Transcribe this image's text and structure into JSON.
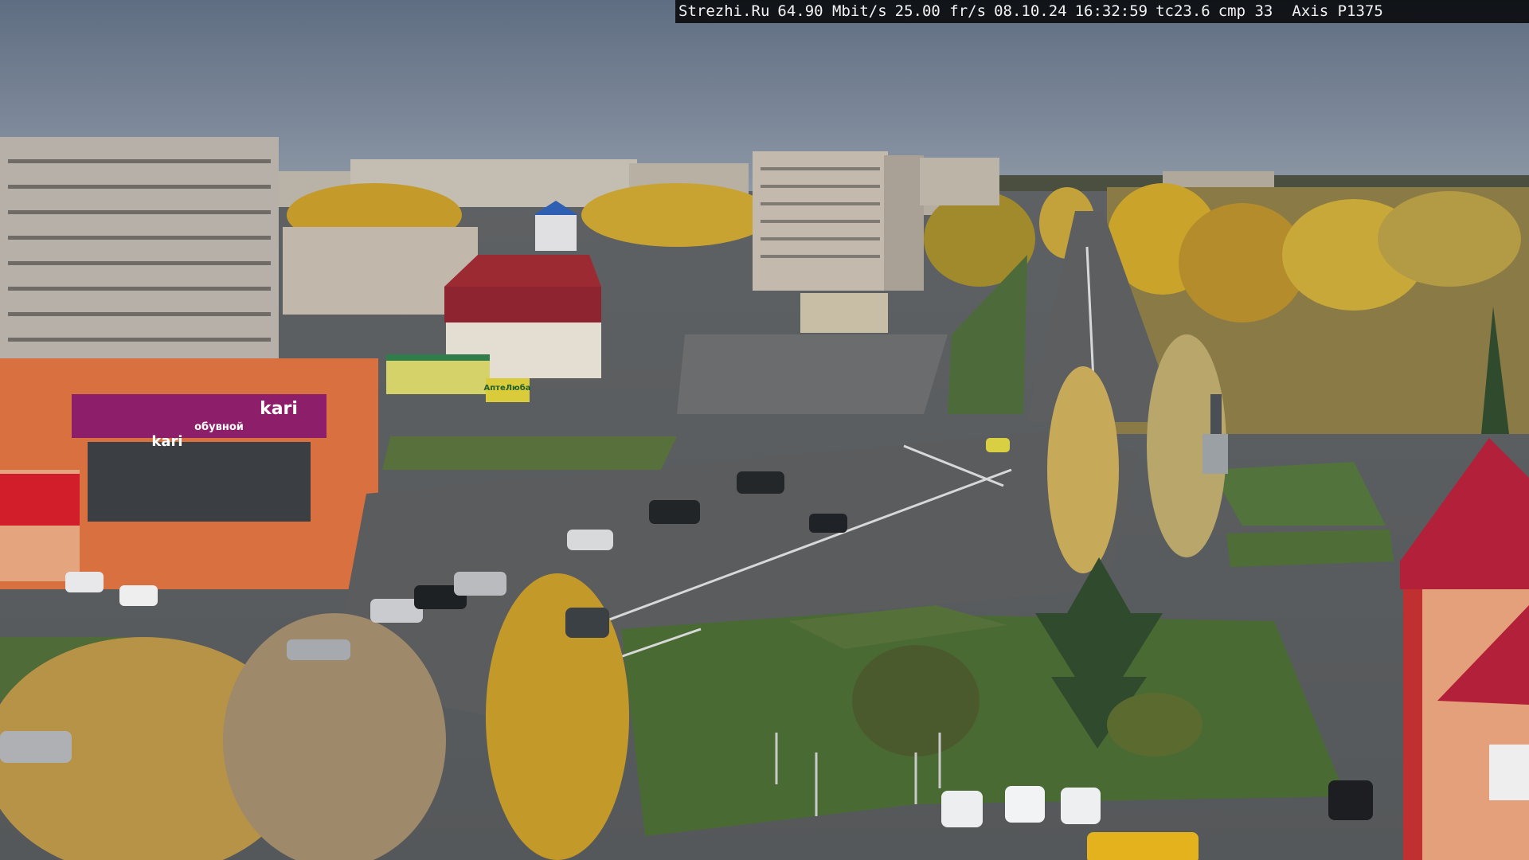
{
  "overlay": {
    "site": "Strezhi.Ru",
    "bitrate": "64.90 Mbit/s",
    "framerate": "25.00 fr/s",
    "date": "08.10.24",
    "time": "16:32:59",
    "tc": "tc23.6",
    "cmp": "cmp 33",
    "camera_model": "Axis P1375"
  },
  "signs": {
    "store_logo": "kari",
    "store_sub": "обувной",
    "store_logo_small": "kari",
    "pharmacy": "АптеЛюба"
  },
  "colors": {
    "sky": "#6f7d90",
    "asphalt": "#5a5d60",
    "grass": "#4d6b3a",
    "foliage_autumn": "#c9a32a",
    "store_magenta": "#8c1e6a",
    "store_orange": "#d9703f",
    "roof_red": "#b3203a"
  }
}
